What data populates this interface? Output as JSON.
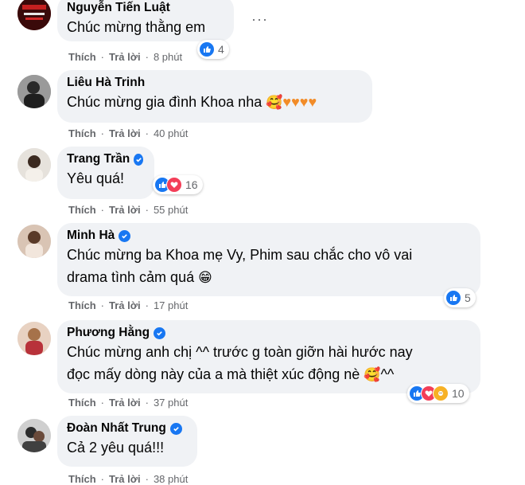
{
  "comments": [
    {
      "name": "Nguyễn Tiến Luật",
      "text": "Chúc mừng thằng em",
      "like": "Thích",
      "reply": "Trả lời",
      "time": "8 phút",
      "reactions_count": "4",
      "verified": false
    },
    {
      "name": "Liêu Hà Trinh",
      "text": "Chúc mừng gia đình Khoa nha",
      "like": "Thích",
      "reply": "Trả lời",
      "time": "40 phút",
      "reactions_count": "",
      "verified": false
    },
    {
      "name": "Trang Trần",
      "text": "Yêu quá!",
      "like": "Thích",
      "reply": "Trả lời",
      "time": "55 phút",
      "reactions_count": "16",
      "verified": true
    },
    {
      "name": "Minh Hà",
      "text_line1": "Chúc mừng ba Khoa mẹ Vy, Phim sau chắc cho vô vai",
      "text_line2": "drama tình cảm quá",
      "like": "Thích",
      "reply": "Trả lời",
      "time": "17 phút",
      "reactions_count": "5",
      "verified": true
    },
    {
      "name": "Phương Hằng",
      "text_line1": "Chúc mừng anh chị ^^ trước g toàn giỡn hài hước nay",
      "text_line2": "đọc mấy dòng này của a mà thiệt xúc động nè",
      "text_line2_suffix": "^^",
      "like": "Thích",
      "reply": "Trả lời",
      "time": "37 phút",
      "reactions_count": "10",
      "verified": true
    },
    {
      "name": "Đoàn Nhất Trung",
      "text": "Cả 2 yêu quá!!!",
      "like": "Thích",
      "reply": "Trả lời",
      "time": "38 phút",
      "reactions_count": "",
      "verified": true
    }
  ],
  "more_options": "···",
  "colors": {
    "bubble": "#f0f2f5",
    "like_blue": "#1877f2",
    "love_red": "#f33e58",
    "meta_gray": "#65676b"
  }
}
